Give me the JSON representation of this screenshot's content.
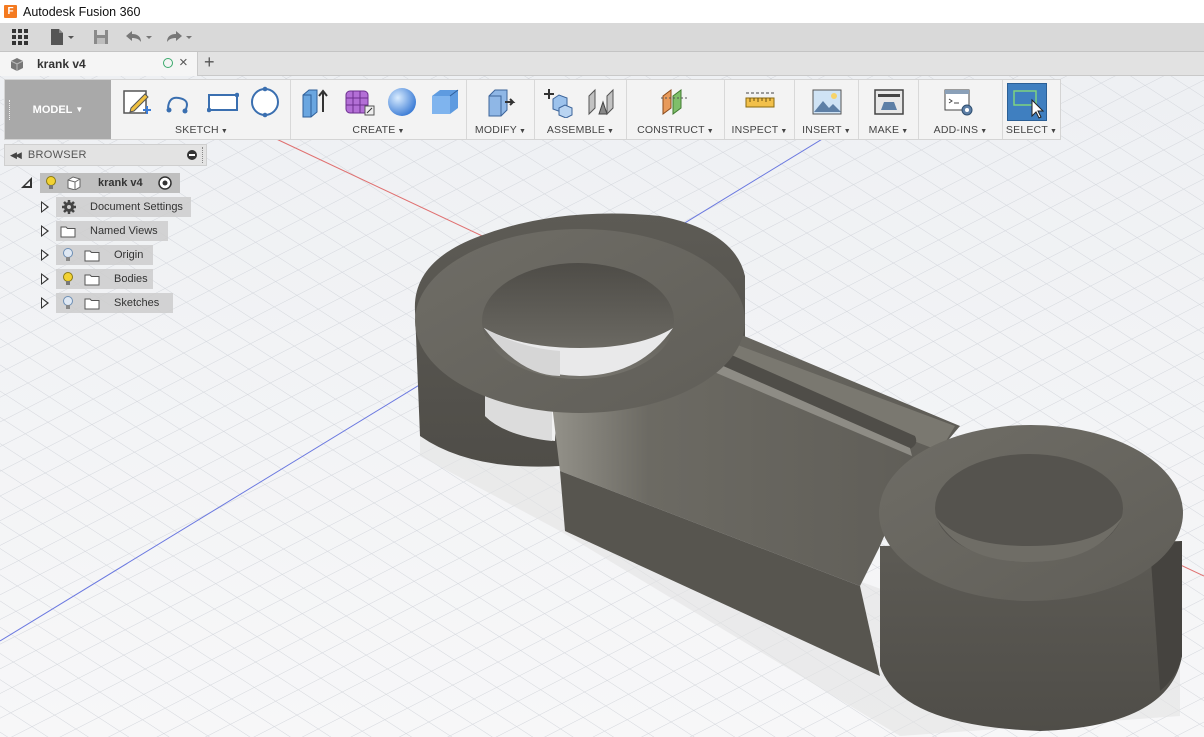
{
  "window": {
    "title": "Autodesk Fusion 360",
    "logo_letter": "F"
  },
  "document_tab": {
    "label": "krank v4",
    "close": "×",
    "new_tab": "+"
  },
  "toolbar": {
    "workspace": "MODEL",
    "groups": [
      {
        "label": "SKETCH"
      },
      {
        "label": "CREATE"
      },
      {
        "label": "MODIFY"
      },
      {
        "label": "ASSEMBLE"
      },
      {
        "label": "CONSTRUCT"
      },
      {
        "label": "INSPECT"
      },
      {
        "label": "INSERT"
      },
      {
        "label": "MAKE"
      },
      {
        "label": "ADD-INS"
      },
      {
        "label": "SELECT"
      }
    ],
    "caret": "▼"
  },
  "browser": {
    "title": "BROWSER",
    "root": "krank v4",
    "items": [
      {
        "label": "Document Settings"
      },
      {
        "label": "Named Views"
      },
      {
        "label": "Origin"
      },
      {
        "label": "Bodies"
      },
      {
        "label": "Sketches"
      }
    ]
  },
  "colors": {
    "model_gray": "#6e6c64",
    "select_active": "#3f7fc0",
    "grid_line": "#cfd3da",
    "axis_red": "#e05a5a",
    "axis_blue": "#5a6ee0"
  }
}
